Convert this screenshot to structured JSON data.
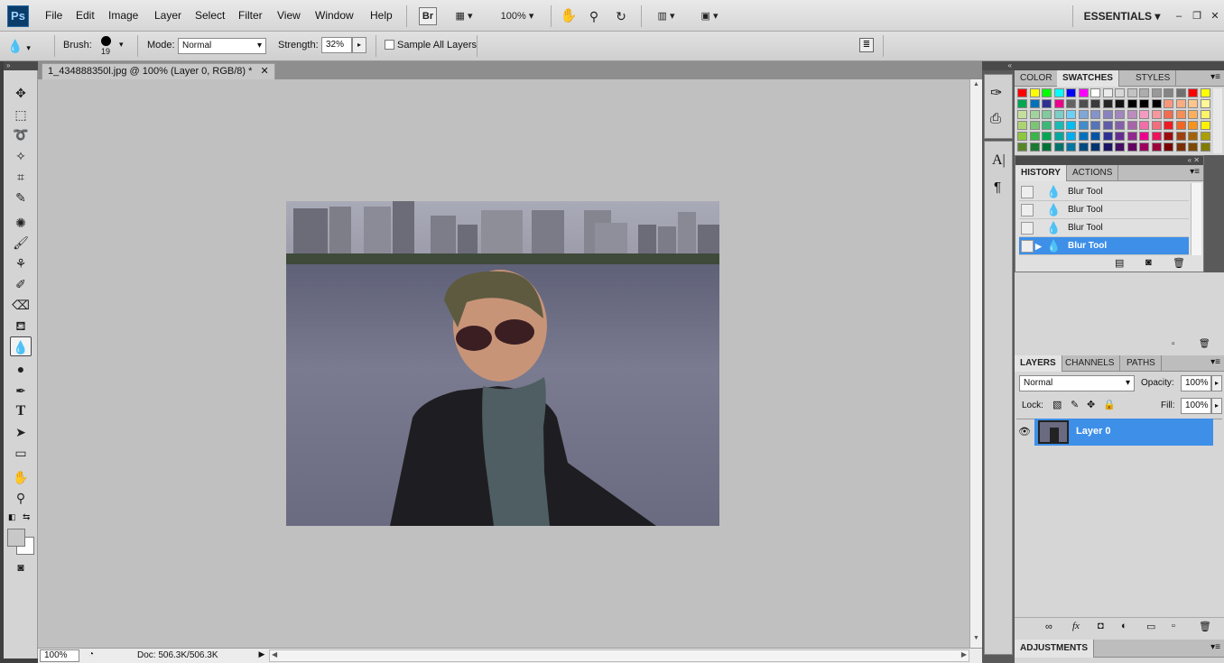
{
  "app": {
    "logo": "Ps",
    "workspace": "ESSENTIALS"
  },
  "menu": [
    "File",
    "Edit",
    "Image",
    "Layer",
    "Select",
    "Filter",
    "View",
    "Window",
    "Help"
  ],
  "appbar": {
    "bridge": "Br",
    "zoom": "100%"
  },
  "options": {
    "brush_label": "Brush:",
    "brush_size": "19",
    "mode_label": "Mode:",
    "mode_value": "Normal",
    "strength_label": "Strength:",
    "strength_value": "32%",
    "sample_all_layers": "Sample All Layers"
  },
  "document": {
    "tab_title": "1_434888350l.jpg @ 100% (Layer 0, RGB/8) *"
  },
  "status": {
    "zoom": "100%",
    "doc": "Doc: 506.3K/506.3K"
  },
  "color_panel": {
    "tabs": [
      "COLOR",
      "SWATCHES",
      "STYLES"
    ],
    "active": 1
  },
  "swatches": {
    "rows": [
      [
        "#ff0000",
        "#ffff00",
        "#00ff00",
        "#00ffff",
        "#0000ff",
        "#ff00ff",
        "#ffffff",
        "#ebebeb",
        "#d6d6d6",
        "#c2c2c2",
        "#adadad",
        "#999999",
        "#858585",
        "#707070",
        "#ff0000",
        "#ffff00"
      ],
      [
        "#00a651",
        "#0072bc",
        "#2e3192",
        "#ec008c",
        "#636363",
        "#4f4f4f",
        "#3b3b3b",
        "#262626",
        "#121212",
        "#000000",
        "#000000",
        "#000000",
        "#f7977a",
        "#fbad82",
        "#fdc68c",
        "#fff799"
      ],
      [
        "#c4df9b",
        "#a3d39c",
        "#82ca9d",
        "#7bcdc8",
        "#6ecff6",
        "#7ea7d8",
        "#8493ca",
        "#8882be",
        "#a187be",
        "#bc8cbf",
        "#f49ac2",
        "#f6989d",
        "#f26c4f",
        "#f68e55",
        "#fbaf5c",
        "#fff467"
      ],
      [
        "#acd372",
        "#7cc576",
        "#3bb878",
        "#1abbb4",
        "#00bff3",
        "#438ccb",
        "#5574b9",
        "#605ca8",
        "#8560a8",
        "#a864a8",
        "#f06ea9",
        "#f26d7d",
        "#ed1c24",
        "#f26522",
        "#f7941d",
        "#fff200"
      ],
      [
        "#8dc73f",
        "#39b54a",
        "#00a651",
        "#00a99d",
        "#00aeef",
        "#0072bc",
        "#0054a6",
        "#2e3192",
        "#662d91",
        "#92278f",
        "#ec008c",
        "#ed145b",
        "#9e0b0f",
        "#a0410d",
        "#a36209",
        "#aba000"
      ],
      [
        "#598527",
        "#197b30",
        "#007236",
        "#00746b",
        "#0076a3",
        "#004b80",
        "#003471",
        "#1b1464",
        "#440e62",
        "#630460",
        "#9e005d",
        "#9e0039",
        "#790000",
        "#7b2e00",
        "#7d4900",
        "#827b00"
      ]
    ]
  },
  "history_panel": {
    "tabs": [
      "HISTORY",
      "ACTIONS"
    ],
    "active": 0,
    "items": [
      "Blur Tool",
      "Blur Tool",
      "Blur Tool",
      "Blur Tool"
    ]
  },
  "layers_panel": {
    "tabs": [
      "LAYERS",
      "CHANNELS",
      "PATHS"
    ],
    "active": 0,
    "blend_mode": "Normal",
    "opacity_label": "Opacity:",
    "opacity": "100%",
    "lock_label": "Lock:",
    "fill_label": "Fill:",
    "fill": "100%",
    "layer_name": "Layer 0"
  },
  "adjustments_panel": {
    "title": "ADJUSTMENTS"
  }
}
